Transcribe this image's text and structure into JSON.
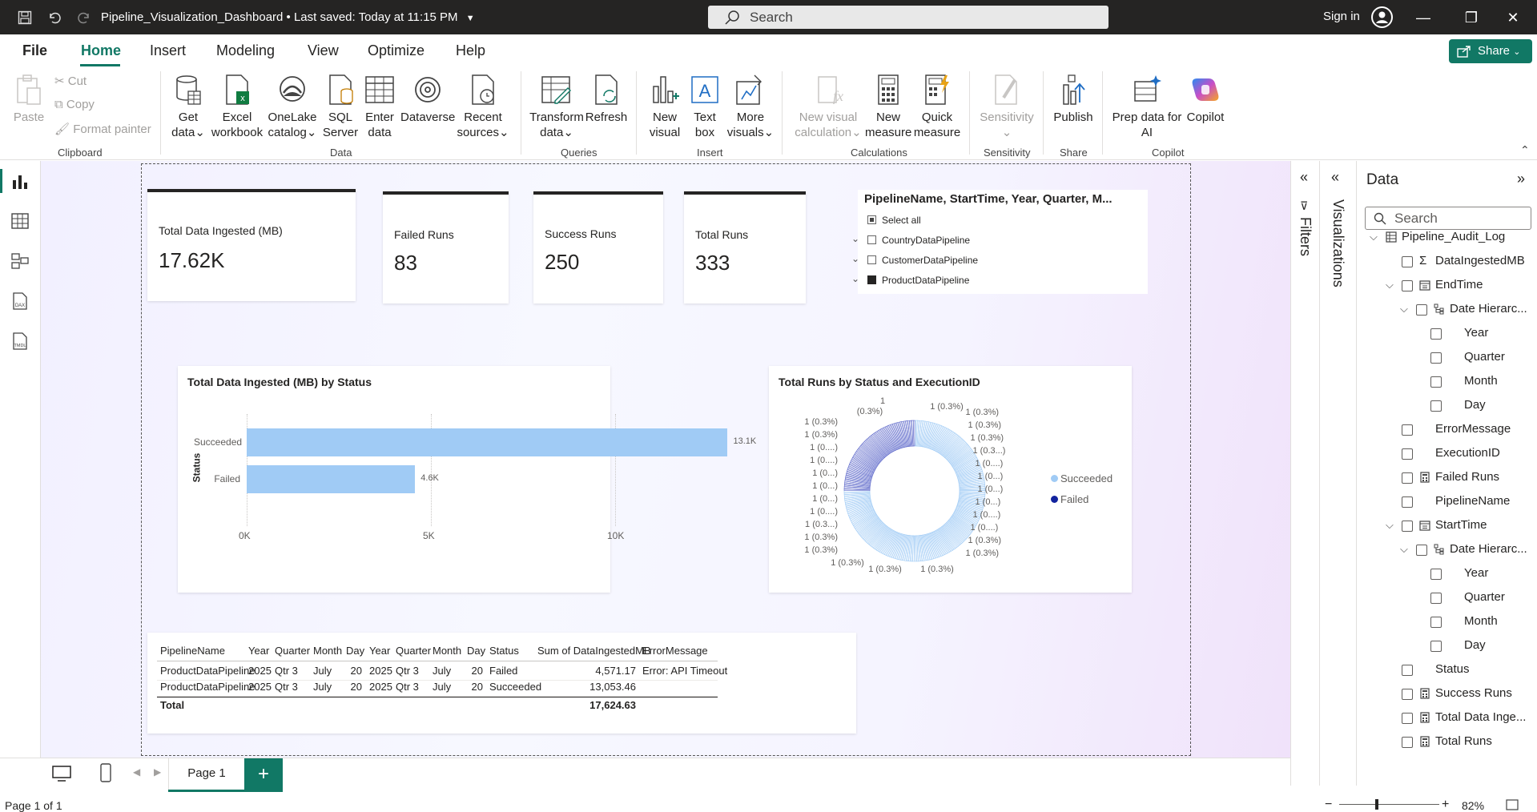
{
  "titlebar": {
    "title": "Pipeline_Visualization_Dashboard  •  Last saved: Today at 11:15 PM",
    "search_placeholder": "Search",
    "signin": "Sign in"
  },
  "menu": {
    "file": "File",
    "home": "Home",
    "insert": "Insert",
    "modeling": "Modeling",
    "view": "View",
    "optimize": "Optimize",
    "help": "Help",
    "share": "Share"
  },
  "ribbon": {
    "paste": "Paste",
    "cut": "Cut",
    "copy": "Copy",
    "format_painter": "Format painter",
    "clipboard": "Clipboard",
    "get_data_1": "Get",
    "get_data_2": "data",
    "excel_1": "Excel",
    "excel_2": "workbook",
    "onelake_1": "OneLake",
    "onelake_2": "catalog",
    "sql_1": "SQL",
    "sql_2": "Server",
    "enter_1": "Enter",
    "enter_2": "data",
    "dataverse": "Dataverse",
    "recent_1": "Recent",
    "recent_2": "sources",
    "data_group": "Data",
    "transform_1": "Transform",
    "transform_2": "data",
    "refresh": "Refresh",
    "queries_group": "Queries",
    "new_visual_1": "New",
    "new_visual_2": "visual",
    "text_box_1": "Text",
    "text_box_2": "box",
    "more_visuals_1": "More",
    "more_visuals_2": "visuals",
    "insert_group": "Insert",
    "new_visual_calc_1": "New visual",
    "new_visual_calc_2": "calculation",
    "new_measure_1": "New",
    "new_measure_2": "measure",
    "quick_measure_1": "Quick",
    "quick_measure_2": "measure",
    "calculations_group": "Calculations",
    "sensitivity": "Sensitivity",
    "sensitivity_group": "Sensitivity",
    "publish": "Publish",
    "share_group": "Share",
    "prep_1": "Prep data for",
    "prep_2": "AI",
    "copilot": "Copilot",
    "copilot_group": "Copilot"
  },
  "kpis": [
    {
      "label": "Total Data Ingested (MB)",
      "value": "17.62K"
    },
    {
      "label": "Failed Runs",
      "value": "83"
    },
    {
      "label": "Success Runs",
      "value": "250"
    },
    {
      "label": "Total Runs",
      "value": "333"
    }
  ],
  "slicer": {
    "title": "PipelineName, StartTime, Year, Quarter, M...",
    "items": [
      "Select all",
      "CountryDataPipeline",
      "CustomerDataPipeline",
      "ProductDataPipeline"
    ]
  },
  "chart_data": [
    {
      "type": "bar",
      "title": "Total Data Ingested (MB) by Status",
      "ylabel": "Status",
      "xlabel": "",
      "categories": [
        "Succeeded",
        "Failed"
      ],
      "values": [
        13053.46,
        4571.17
      ],
      "data_labels": [
        "13.1K",
        "4.6K"
      ],
      "xticks": [
        "0K",
        "5K",
        "10K"
      ],
      "xlim": [
        0,
        13500
      ],
      "color": "#a0cbf5"
    },
    {
      "type": "pie",
      "title": "Total Runs by Status and ExecutionID",
      "legend": [
        "Succeeded",
        "Failed"
      ],
      "legend_colors": [
        "#a0cbf5",
        "#12239e"
      ],
      "series": [
        {
          "name": "Succeeded",
          "value": 250
        },
        {
          "name": "Failed",
          "value": 83
        }
      ],
      "slice_value": 1,
      "slice_labels_left": [
        "1 (0.3%)",
        "1 (0.3%)",
        "1 (0....)",
        "1 (0....)",
        "1 (0...)",
        "1 (0...)",
        "1 (0...)",
        "1 (0....)",
        "1 (0.3...)",
        "1 (0.3%)",
        "1 (0.3%)"
      ],
      "slice_labels_right": [
        "1 (0.3%)",
        "1 (0.3%)",
        "1 (0.3%)",
        "1 (0.3...)",
        "1 (0....)",
        "1 (0...)",
        "1 (0...)",
        "1 (0...)",
        "1 (0....)",
        "1 (0....)",
        "1 (0.3%)",
        "1 (0.3%)"
      ],
      "slice_labels_top": [
        "1",
        "(0.3%)",
        "1 (0.3%)"
      ],
      "slice_labels_bottom": [
        "1 (0.3%)",
        "1 (0.3%)",
        "1 (0.3%)"
      ]
    }
  ],
  "table": {
    "headers": [
      "PipelineName",
      "Year",
      "Quarter",
      "Month",
      "Day",
      "Year",
      "Quarter",
      "Month",
      "Day",
      "Status",
      "Sum of DataIngestedMB",
      "ErrorMessage"
    ],
    "rows": [
      [
        "ProductDataPipeline",
        "2025",
        "Qtr 3",
        "July",
        "20",
        "2025",
        "Qtr 3",
        "July",
        "20",
        "Failed",
        "4,571.17",
        "Error: API Timeout"
      ],
      [
        "ProductDataPipeline",
        "2025",
        "Qtr 3",
        "July",
        "20",
        "2025",
        "Qtr 3",
        "July",
        "20",
        "Succeeded",
        "13,053.46",
        ""
      ]
    ],
    "total_label": "Total",
    "total_value": "17,624.63"
  },
  "panels": {
    "filters": "Filters",
    "visualizations": "Visualizations",
    "data": "Data",
    "data_search": "Search"
  },
  "data_tree": [
    {
      "label": "Pipeline_Audit_Log",
      "icon": "table-icon"
    },
    {
      "label": "DataIngestedMB",
      "icon": "sigma-icon"
    },
    {
      "label": "EndTime",
      "icon": "calendar-icon"
    },
    {
      "label": "Date Hierarc...",
      "icon": "hierarchy-icon"
    },
    {
      "label": "Year"
    },
    {
      "label": "Quarter"
    },
    {
      "label": "Month"
    },
    {
      "label": "Day"
    },
    {
      "label": "ErrorMessage"
    },
    {
      "label": "ExecutionID"
    },
    {
      "label": "Failed Runs",
      "icon": "calculator-icon"
    },
    {
      "label": "PipelineName"
    },
    {
      "label": "StartTime",
      "icon": "calendar-icon"
    },
    {
      "label": "Date Hierarc...",
      "icon": "hierarchy-icon"
    },
    {
      "label": "Year"
    },
    {
      "label": "Quarter"
    },
    {
      "label": "Month"
    },
    {
      "label": "Day"
    },
    {
      "label": "Status"
    },
    {
      "label": "Success Runs",
      "icon": "calculator-icon"
    },
    {
      "label": "Total Data Inge...",
      "icon": "calculator-icon"
    },
    {
      "label": "Total Runs",
      "icon": "calculator-icon"
    }
  ],
  "bottom": {
    "page_tab": "Page 1",
    "add": "+",
    "status": "Page 1 of 1",
    "zoom": "82%"
  },
  "colors": {
    "accent": "#117865",
    "titlebar": "#252423",
    "bar": "#a0cbf5",
    "failed": "#12239e"
  }
}
